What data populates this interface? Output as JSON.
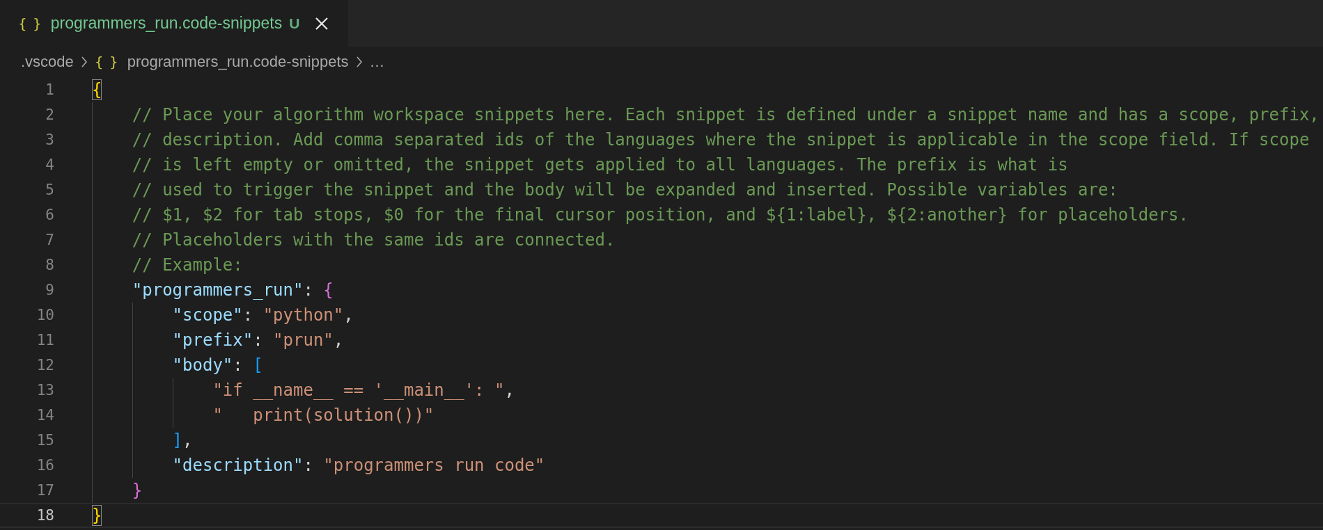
{
  "tabs": [
    {
      "icon": "{ }",
      "label": "programmers_run.code-snippets",
      "status": "U",
      "selected": true
    }
  ],
  "breadcrumbs": [
    {
      "kind": "folder",
      "label": ".vscode"
    },
    {
      "kind": "file",
      "icon": "{ }",
      "label": "programmers_run.code-snippets"
    },
    {
      "kind": "more",
      "label": "…"
    }
  ],
  "editor": {
    "lines": [
      {
        "number": "1",
        "current": false,
        "tokens": [
          {
            "kind": "brace1",
            "text": "{",
            "matched": true
          }
        ],
        "children": [
          {
            "number": "2",
            "current": false,
            "tokens": [
              {
                "kind": "comment",
                "text": "// Place your algorithm workspace snippets here. Each snippet is defined under a snippet name and has a scope, prefix,"
              }
            ]
          },
          {
            "number": "3",
            "current": false,
            "tokens": [
              {
                "kind": "comment",
                "text": "// description. Add comma separated ids of the languages where the snippet is applicable in the scope field. If scope"
              }
            ]
          },
          {
            "number": "4",
            "current": false,
            "tokens": [
              {
                "kind": "comment",
                "text": "// is left empty or omitted, the snippet gets applied to all languages. The prefix is what is"
              }
            ]
          },
          {
            "number": "5",
            "current": false,
            "tokens": [
              {
                "kind": "comment",
                "text": "// used to trigger the snippet and the body will be expanded and inserted. Possible variables are:"
              }
            ]
          },
          {
            "number": "6",
            "current": false,
            "tokens": [
              {
                "kind": "comment",
                "text": "// $1, $2 for tab stops, $0 for the final cursor position, and ${1:label}, ${2:another} for placeholders."
              }
            ]
          },
          {
            "number": "7",
            "current": false,
            "tokens": [
              {
                "kind": "comment",
                "text": "// Placeholders with the same ids are connected."
              }
            ]
          },
          {
            "number": "8",
            "current": false,
            "tokens": [
              {
                "kind": "comment",
                "text": "// Example:"
              }
            ]
          },
          {
            "number": "9",
            "current": false,
            "tokens": [
              {
                "kind": "key",
                "text": "\"programmers_run\""
              },
              {
                "kind": "punct",
                "text": ": "
              },
              {
                "kind": "brace2",
                "text": "{"
              }
            ],
            "children": [
              {
                "number": "10",
                "current": false,
                "tokens": [
                  {
                    "kind": "key",
                    "text": "\"scope\""
                  },
                  {
                    "kind": "punct",
                    "text": ": "
                  },
                  {
                    "kind": "string",
                    "text": "\"python\""
                  },
                  {
                    "kind": "punct",
                    "text": ","
                  }
                ]
              },
              {
                "number": "11",
                "current": false,
                "tokens": [
                  {
                    "kind": "key",
                    "text": "\"prefix\""
                  },
                  {
                    "kind": "punct",
                    "text": ": "
                  },
                  {
                    "kind": "string",
                    "text": "\"prun\""
                  },
                  {
                    "kind": "punct",
                    "text": ","
                  }
                ]
              },
              {
                "number": "12",
                "current": false,
                "tokens": [
                  {
                    "kind": "key",
                    "text": "\"body\""
                  },
                  {
                    "kind": "punct",
                    "text": ": "
                  },
                  {
                    "kind": "bracket3",
                    "text": "["
                  }
                ],
                "children": [
                  {
                    "number": "13",
                    "current": false,
                    "tokens": [
                      {
                        "kind": "string",
                        "text": "\"if __name__ == '__main__': \""
                      },
                      {
                        "kind": "punct",
                        "text": ","
                      }
                    ]
                  },
                  {
                    "number": "14",
                    "current": false,
                    "tokens": [
                      {
                        "kind": "string",
                        "text": "\"   print(solution())\""
                      }
                    ]
                  }
                ]
              },
              {
                "number": "15",
                "current": false,
                "tokens": [
                  {
                    "kind": "bracket3",
                    "text": "]"
                  },
                  {
                    "kind": "punct",
                    "text": ","
                  }
                ]
              },
              {
                "number": "16",
                "current": false,
                "tokens": [
                  {
                    "kind": "key",
                    "text": "\"description\""
                  },
                  {
                    "kind": "punct",
                    "text": ": "
                  },
                  {
                    "kind": "string",
                    "text": "\"programmers run code\""
                  }
                ]
              }
            ]
          },
          {
            "number": "17",
            "current": false,
            "tokens": [
              {
                "kind": "brace2",
                "text": "}"
              }
            ]
          }
        ]
      },
      {
        "number": "18",
        "current": true,
        "tokens": [
          {
            "kind": "brace1",
            "text": "}",
            "matched": true
          }
        ]
      }
    ]
  }
}
